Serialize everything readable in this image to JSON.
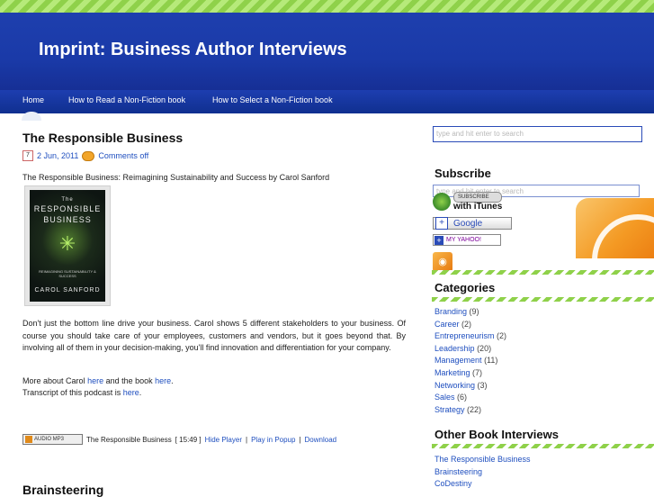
{
  "site": {
    "title": "Imprint: Business Author Interviews"
  },
  "nav": {
    "items": [
      "Home",
      "How to Read a Non-Fiction book",
      "How to Select a Non-Fiction book"
    ],
    "search_placeholder": "type and hit enter to search"
  },
  "post": {
    "title": "The Responsible Business",
    "date": "2 Jun, 2011",
    "comments": "Comments off",
    "intro": "The Responsible Business: Reimagining Sustainability and Success by Carol Sanford",
    "book": {
      "line1": "The",
      "line2": "RESPONSIBLE",
      "line3": "BUSINESS",
      "subtitle": "REIMAGINING SUSTAINABILITY & SUCCESS",
      "author": "CAROL SANFORD"
    },
    "body": "Don't just the bottom line drive your business. Carol shows 5 different stakeholders to your business. Of course you should take care of your employees, customers and vendors, but it goes beyond that. By involving all of them in your decision-making, you'll find innovation and differentiation for your company.",
    "more_prefix": "More about Carol",
    "more_link1": "here",
    "more_mid": "and the book",
    "more_link2": "here",
    "more_end": ".",
    "transcript_prefix": "Transcript of this podcast is",
    "transcript_link": "here",
    "player": {
      "badge": "AUDIO MP3",
      "title": "The Responsible Business",
      "duration": "[ 15:49 ]",
      "hide": "Hide Player",
      "popup": "Play in Popup",
      "download": "Download",
      "sep": "|"
    }
  },
  "next_post_title": "Brainsteering",
  "sidebar": {
    "search_placeholder": "type and hit enter to search",
    "subscribe_title": "Subscribe",
    "itunes_pill": "SUBSCRIBE",
    "itunes_label": "with iTunes",
    "google_label": "Google",
    "yahoo_label": "MY YAHOO!",
    "categories_title": "Categories",
    "categories": [
      {
        "name": "Branding",
        "count": "(9)"
      },
      {
        "name": "Career",
        "count": "(2)"
      },
      {
        "name": "Entrepreneurism",
        "count": "(2)"
      },
      {
        "name": "Leadership",
        "count": "(20)"
      },
      {
        "name": "Management",
        "count": "(11)"
      },
      {
        "name": "Marketing",
        "count": "(7)"
      },
      {
        "name": "Networking",
        "count": "(3)"
      },
      {
        "name": "Sales",
        "count": "(6)"
      },
      {
        "name": "Strategy",
        "count": "(22)"
      }
    ],
    "other_title": "Other Book Interviews",
    "other_items": [
      "The Responsible Business",
      "Brainsteering",
      "CoDestiny"
    ]
  },
  "colors": {
    "header_blue": "#1a3aa8",
    "link_blue": "#1f4fbf",
    "accent_green": "#8fd14a",
    "rss_orange": "#f49a24"
  }
}
